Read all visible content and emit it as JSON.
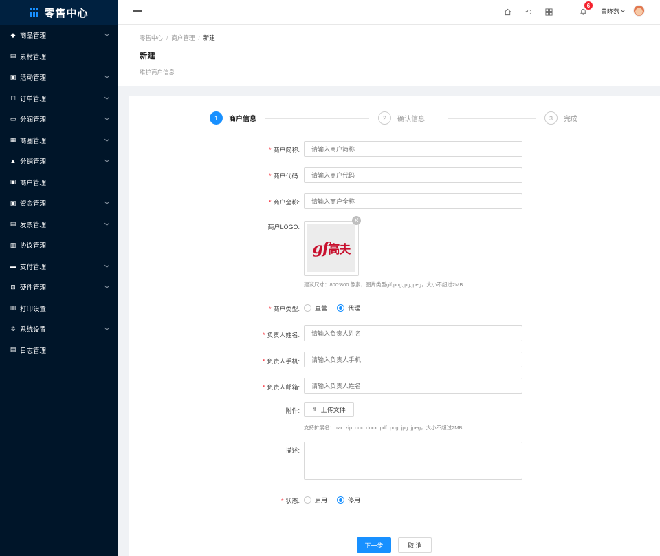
{
  "app": {
    "title": "零售中心"
  },
  "sidebar": {
    "items": [
      {
        "label": "商品管理",
        "icon": "tag-icon",
        "expandable": true
      },
      {
        "label": "素材管理",
        "icon": "file-icon",
        "expandable": false
      },
      {
        "label": "活动管理",
        "icon": "calendar-icon",
        "expandable": true
      },
      {
        "label": "订单管理",
        "icon": "bookmark-icon",
        "expandable": true
      },
      {
        "label": "分润管理",
        "icon": "monitor-icon",
        "expandable": true
      },
      {
        "label": "商圈管理",
        "icon": "apps-icon",
        "expandable": true
      },
      {
        "label": "分销管理",
        "icon": "home-icon",
        "expandable": true
      },
      {
        "label": "商户管理",
        "icon": "contacts-icon",
        "expandable": false
      },
      {
        "label": "资金管理",
        "icon": "calendar-icon",
        "expandable": true
      },
      {
        "label": "发票管理",
        "icon": "invoice-icon",
        "expandable": true
      },
      {
        "label": "协议管理",
        "icon": "document-icon",
        "expandable": false
      },
      {
        "label": "支付管理",
        "icon": "credit-card-icon",
        "expandable": true
      },
      {
        "label": "硬件管理",
        "icon": "hardware-icon",
        "expandable": true
      },
      {
        "label": "打印设置",
        "icon": "printer-icon",
        "expandable": false
      },
      {
        "label": "系统设置",
        "icon": "gear-icon",
        "expandable": true
      },
      {
        "label": "日志管理",
        "icon": "log-icon",
        "expandable": false
      }
    ]
  },
  "header": {
    "notification_count": "6",
    "user_name": "黄晓燕"
  },
  "breadcrumb": {
    "items": [
      "零售中心",
      "商户管理",
      "新建"
    ]
  },
  "page": {
    "title": "新建",
    "description": "维护商户信息"
  },
  "steps": [
    {
      "num": "1",
      "label": "商户信息",
      "state": "active"
    },
    {
      "num": "2",
      "label": "确认信息",
      "state": "todo"
    },
    {
      "num": "3",
      "label": "完成",
      "state": "todo"
    }
  ],
  "form": {
    "short_name": {
      "label": "商户简称:",
      "placeholder": "请输入商户简称"
    },
    "code": {
      "label": "商户代码:",
      "placeholder": "请输入商户代码"
    },
    "full_name": {
      "label": "商户全称:",
      "placeholder": "请输入商户全称"
    },
    "logo": {
      "label": "商户LOGO:",
      "image_text": "gf",
      "image_text_cn": "高夫",
      "hint": "建议尺寸：800*800 像素，图片类型gif,png,jpg,jpeg，大小不超过2MB"
    },
    "type": {
      "label": "商户类型:",
      "options": [
        "直营",
        "代理"
      ],
      "selected": "代理"
    },
    "contact_name": {
      "label": "负责人姓名:",
      "placeholder": "请输入负责人姓名"
    },
    "contact_phone": {
      "label": "负责人手机:",
      "placeholder": "请输入负责人手机"
    },
    "contact_email": {
      "label": "负责人邮箱:",
      "placeholder": "请输入负责人姓名"
    },
    "attachment": {
      "label": "附件:",
      "button": "上传文件",
      "hint": "支持扩展名：.rar .zip .doc .docx .pdf .png .jpg .jpeg，大小不超过2MB"
    },
    "description": {
      "label": "描述:"
    },
    "status": {
      "label": "状态:",
      "options": [
        "启用",
        "停用"
      ],
      "selected": "停用"
    }
  },
  "actions": {
    "next": "下一步",
    "cancel": "取 消"
  },
  "colors": {
    "primary": "#1890ff",
    "sidebar": "#001529",
    "required": "#f5222d"
  }
}
